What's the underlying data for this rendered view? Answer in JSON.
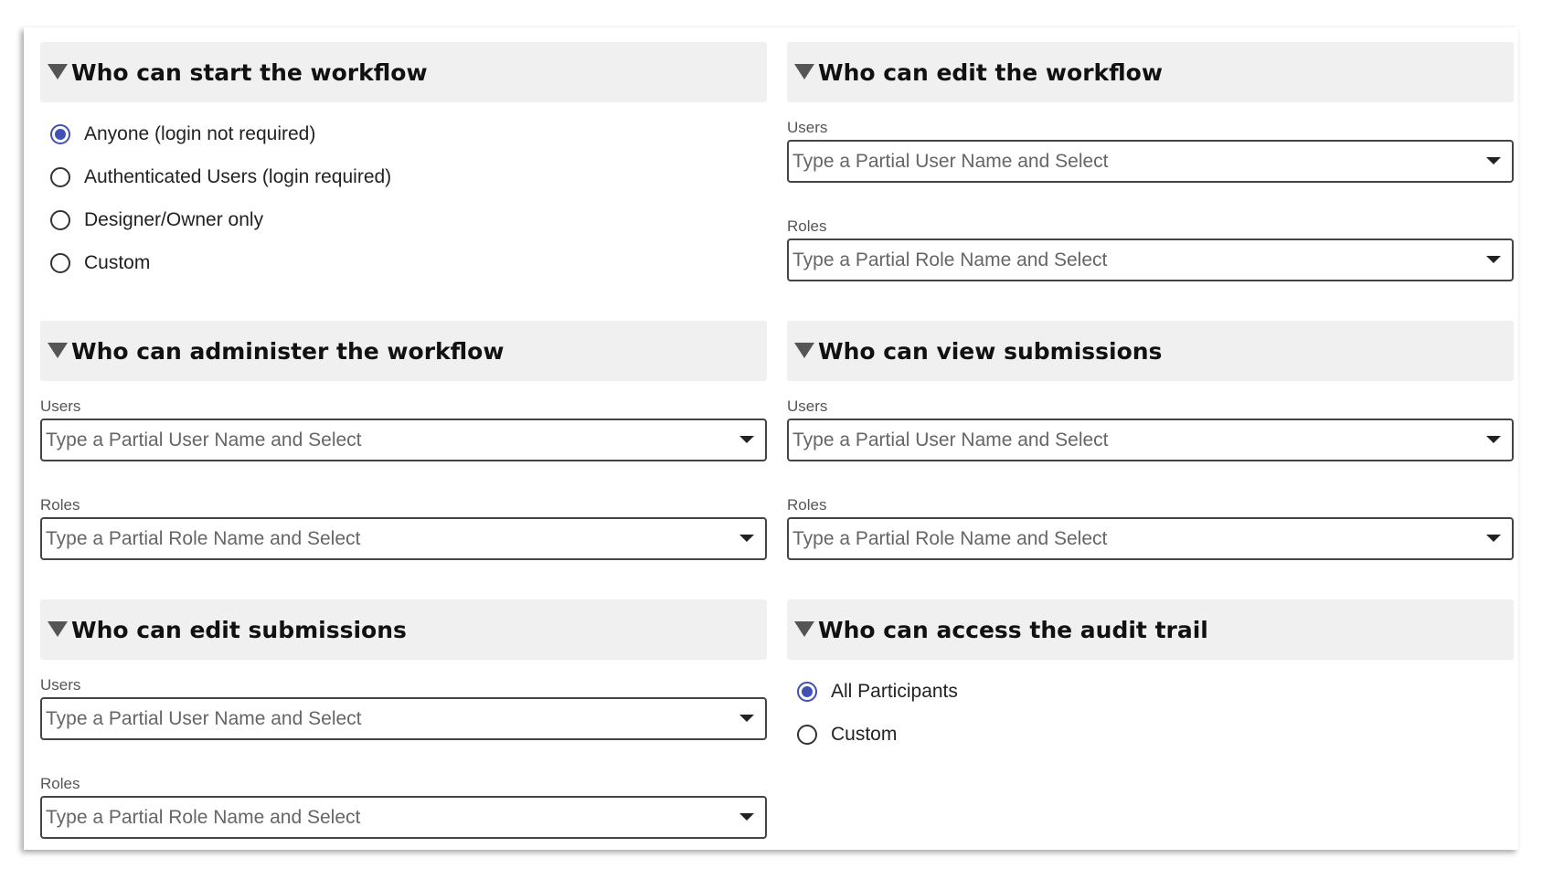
{
  "sections": {
    "start": {
      "title": "Who can start the workflow",
      "options": [
        {
          "label": "Anyone (login not required)",
          "checked": true
        },
        {
          "label": "Authenticated Users (login required)",
          "checked": false
        },
        {
          "label": "Designer/Owner only",
          "checked": false
        },
        {
          "label": "Custom",
          "checked": false
        }
      ]
    },
    "edit_workflow": {
      "title": "Who can edit the workflow",
      "users_label": "Users",
      "users_placeholder": "Type a Partial User Name and Select",
      "roles_label": "Roles",
      "roles_placeholder": "Type a Partial Role Name and Select"
    },
    "administer": {
      "title": "Who can administer the workflow",
      "users_label": "Users",
      "users_placeholder": "Type a Partial User Name and Select",
      "roles_label": "Roles",
      "roles_placeholder": "Type a Partial Role Name and Select"
    },
    "view_submissions": {
      "title": "Who can view submissions",
      "users_label": "Users",
      "users_placeholder": "Type a Partial User Name and Select",
      "roles_label": "Roles",
      "roles_placeholder": "Type a Partial Role Name and Select"
    },
    "edit_submissions": {
      "title": "Who can edit submissions",
      "users_label": "Users",
      "users_placeholder": "Type a Partial User Name and Select",
      "roles_label": "Roles",
      "roles_placeholder": "Type a Partial Role Name and Select"
    },
    "audit_trail": {
      "title": "Who can access the audit trail",
      "options": [
        {
          "label": "All Participants",
          "checked": true
        },
        {
          "label": "Custom",
          "checked": false
        }
      ]
    }
  },
  "colors": {
    "accent": "#3f51b5",
    "header_bg": "#f0f0f0"
  },
  "icons": {
    "collapse": "triangle-down-icon",
    "dropdown": "caret-down-icon"
  }
}
